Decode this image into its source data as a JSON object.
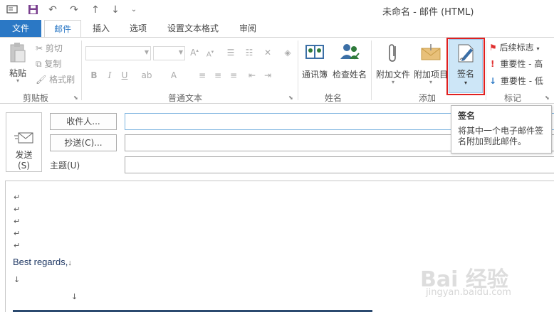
{
  "window": {
    "title": "未命名 - 邮件 (HTML)"
  },
  "quick_access": [
    {
      "name": "outlook-icon",
      "glyph": "▭"
    },
    {
      "name": "save-icon",
      "glyph": "▣"
    },
    {
      "name": "undo-icon",
      "glyph": "↶"
    },
    {
      "name": "redo-icon",
      "glyph": "↷"
    },
    {
      "name": "up-arrow-icon",
      "glyph": "↑"
    },
    {
      "name": "down-arrow-icon",
      "glyph": "↓"
    },
    {
      "name": "customize-icon",
      "glyph": "⌄"
    }
  ],
  "tabs": {
    "file": "文件",
    "mail": "邮件",
    "insert": "插入",
    "options": "选项",
    "format_text": "设置文本格式",
    "review": "审阅"
  },
  "ribbon": {
    "clipboard": {
      "paste": "粘贴",
      "cut": "剪切",
      "copy": "复制",
      "format_painter": "格式刷",
      "group_label": "剪贴板"
    },
    "basic_text": {
      "group_label": "普通文本"
    },
    "names": {
      "address_book": "通讯簿",
      "check_names": "检查姓名",
      "group_label": "姓名"
    },
    "include": {
      "attach_file": "附加文件",
      "attach_item": "附加项目",
      "signature": "签名",
      "group_label": "添加"
    },
    "tags": {
      "follow_up": "后续标志",
      "high_importance": "重要性 - 高",
      "low_importance": "重要性 - 低",
      "group_label": "标记"
    }
  },
  "tooltip": {
    "title": "签名",
    "description": "将其中一个电子邮件签名附加到此邮件。"
  },
  "compose": {
    "send": "发送\n(S)",
    "to": "收件人...",
    "cc": "抄送(C)...",
    "subject": "主题(U)",
    "to_value": "",
    "cc_value": "",
    "subject_value": ""
  },
  "body": {
    "para_mark": "↵",
    "line_mark": "↓",
    "signature_text": "Best regards,"
  },
  "watermark": {
    "brand": "Bai 经验",
    "url": "jingyan.baidu.com"
  },
  "colors": {
    "accent": "#2b78c5",
    "highlight": "#cde6f7",
    "callout_border": "#e02020",
    "flag_red": "#e03030",
    "importance_low": "#2b78c5"
  }
}
